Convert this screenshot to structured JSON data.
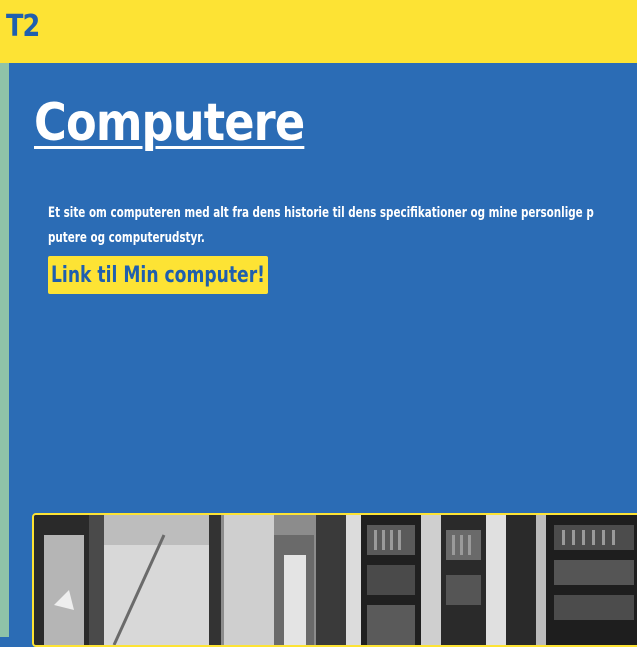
{
  "header": {
    "logo_text": "T2"
  },
  "main": {
    "title": "Computere",
    "intro_line1": "Et site om computeren med alt fra dens historie til dens specifikationer og mine personlige p",
    "intro_line2": "putere og computerudstyr.",
    "link_label": "Link til Min computer!"
  },
  "photo": {
    "subject": "black-and-white photo of early computer racks"
  },
  "colors": {
    "header_bg": "#fde334",
    "page_bg": "#2b6cb5",
    "accent_text": "#1f5fae",
    "left_strip": "#8fc3a8"
  }
}
